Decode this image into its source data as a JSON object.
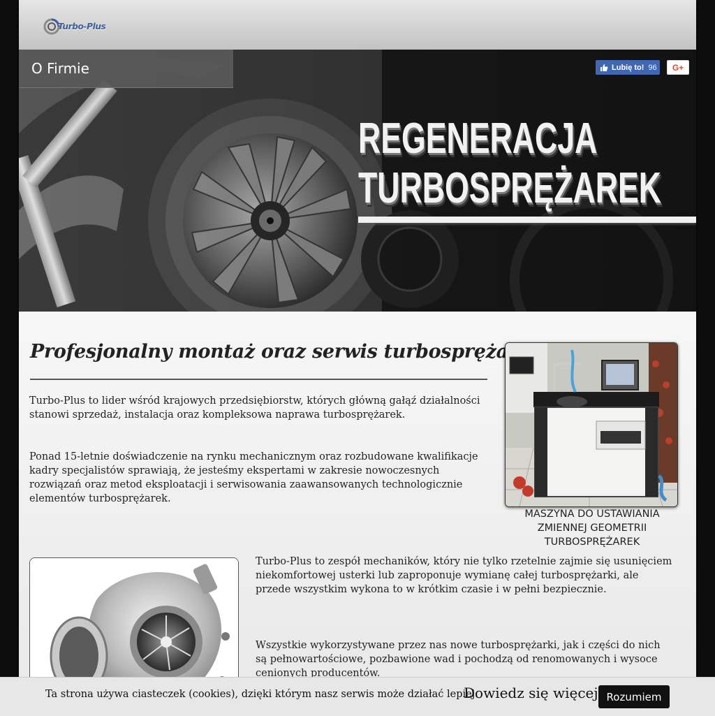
{
  "header": {
    "logo_text": "Turbo-Plus"
  },
  "banner": {
    "page_title": "O Firmie",
    "fb_like_label": "Lubię to!",
    "fb_like_count": "96",
    "gplus_label": "G+",
    "headline_line1": "REGENERACJA",
    "headline_line2": "TURBOSPRĘŻAREK"
  },
  "content": {
    "heading": "Profesjonalny montaż oraz serwis turbosprężarek",
    "paragraph1": "Turbo-Plus to lider wśród krajowych przedsiębiorstw, których główną gałąź działalności stanowi sprzedaż, instalacja oraz kompleksowa naprawa turbosprężarek.",
    "paragraph2": "Ponad 15-letnie doświadczenie na rynku mechanicznym oraz rozbudowane kwalifikacje kadry specjalistów sprawiają, że jesteśmy ekspertami w zakresie nowoczesnych rozwiązań oraz metod eksploatacji i serwisowania zaawansowanych technologicznie elementów turbosprężarek.",
    "paragraph3": "Turbo-Plus to zespół mechaników, który nie tylko rzetelnie zajmie się usunięciem niekomfortowej usterki lub zaproponuje wymianę całej turbosprężarki, ale przede wszystkim wykona to w krótkim czasie i w pełni bezpiecznie.",
    "paragraph4": "Wszystkie wykorzystywane przez nas nowe turbosprężarki, jak i części do nich są pełnowartościowe, pozbawione wad i pochodzą od renomowanych i wysoce cenionych producentów.",
    "photo1_caption": "MASZYNA DO USTAWIANIA ZMIENNEJ GEOMETRII TURBOSPRĘŻAREK"
  },
  "cookie_bar": {
    "text": "Ta strona używa ciasteczek (cookies), dzięki którym nasz serwis może działać lepiej.",
    "link": "Dowiedz się więcej",
    "button": "Rozumiem"
  },
  "icons": {
    "fb": "thumbs-up-icon",
    "gplus": "google-plus-icon",
    "logo": "turbo-logo-icon"
  },
  "colors": {
    "fb_blue": "#4267b2",
    "gplus_red": "#dd4b39",
    "logo_blue": "#3e5d9c"
  }
}
